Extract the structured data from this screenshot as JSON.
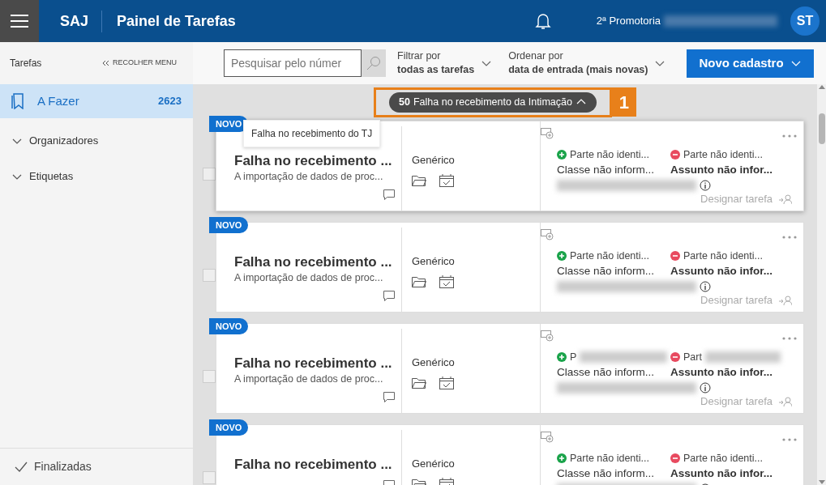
{
  "header": {
    "app": "SAJ",
    "title": "Painel de Tarefas",
    "org": "2ª Promotoria",
    "avatar": "ST"
  },
  "sidebar": {
    "title": "Tarefas",
    "collapse": "RECOLHER MENU",
    "items": [
      {
        "kind": "link",
        "label": "A Fazer",
        "count": "2623",
        "selected": true
      },
      {
        "kind": "group",
        "label": "Organizadores",
        "expanded": false,
        "selected": false
      },
      {
        "kind": "group",
        "label": "Etiquetas",
        "expanded": false,
        "selected": false
      }
    ],
    "footer": "Finalizadas"
  },
  "toolbar": {
    "search": {
      "placeholder": "Pesquisar pelo númer"
    },
    "filter": {
      "label": "Filtrar por",
      "value": "todas as tarefas"
    },
    "sort": {
      "label": "Ordenar por",
      "value": "data de entrada (mais novas)"
    },
    "button": "Novo cadastro"
  },
  "group": {
    "count": "50",
    "label": "Falha no recebimento da Intimação",
    "expanded": true,
    "callout": "1"
  },
  "tooltip": "Falha no recebimento do TJ",
  "cards": [
    {
      "badge": "NOVO",
      "title": "Falha no recebimento ...",
      "description": "A importação de dados de proc...",
      "type": "Genérico",
      "party_active": "Parte não identi...",
      "party_passive": "Parte não identi...",
      "class": "Classe não inform...",
      "subject": "Assunto não infor...",
      "assign": "Designar tarefa",
      "hovered": true,
      "checked": false
    },
    {
      "badge": "NOVO",
      "title": "Falha no recebimento ...",
      "description": "A importação de dados de proc...",
      "type": "Genérico",
      "party_active": "Parte não identi...",
      "party_passive": "Parte não identi...",
      "class": "Classe não inform...",
      "subject": "Assunto não infor...",
      "assign": "Designar tarefa",
      "hovered": false,
      "checked": false
    },
    {
      "badge": "NOVO",
      "title": "Falha no recebimento ...",
      "description": "A importação de dados de proc...",
      "type": "Genérico",
      "party_active": "P",
      "party_passive": "Part",
      "class": "Classe não inform...",
      "subject": "Assunto não infor...",
      "assign": "Designar tarefa",
      "hovered": false,
      "checked": false
    },
    {
      "badge": "NOVO",
      "title": "Falha no recebimento ...",
      "type": "Genérico",
      "party_active": "Parte não identi...",
      "party_passive": "Parte não identi...",
      "class": "Classe não inform...",
      "subject": "Assunto não infor...",
      "hovered": false,
      "checked": false
    }
  ]
}
